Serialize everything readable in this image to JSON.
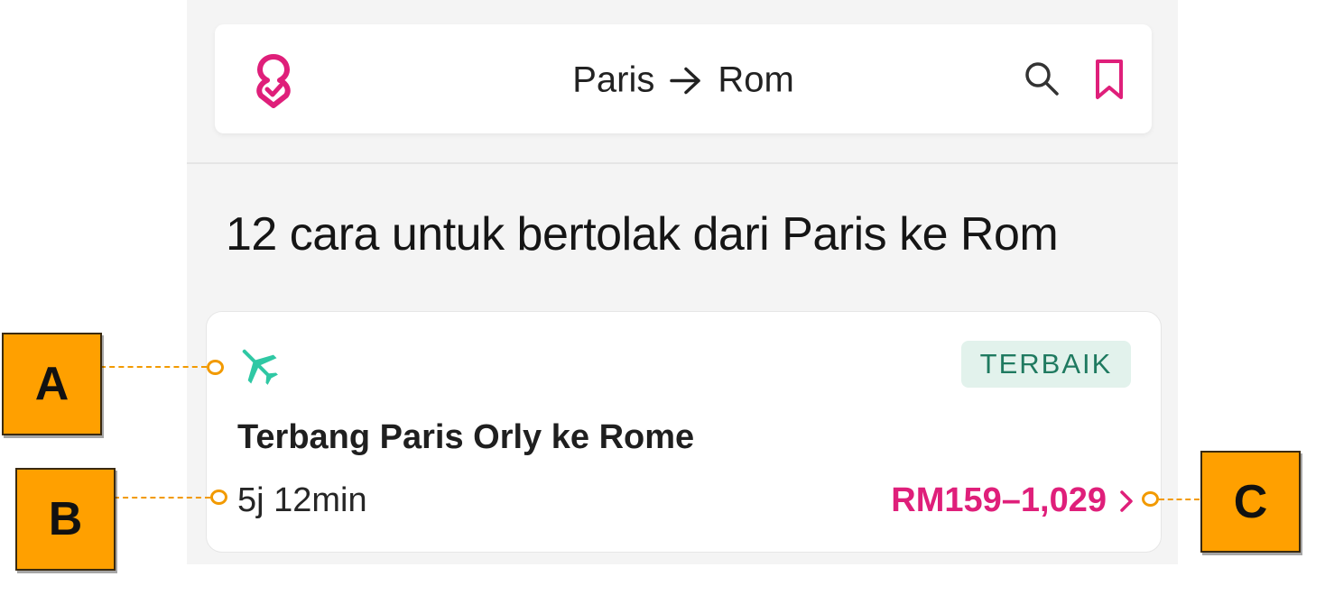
{
  "header": {
    "origin": "Paris",
    "destination": "Rom",
    "icons": {
      "logo": "rome2rio-logo-icon",
      "arrow": "arrow-right-icon",
      "search": "search-icon",
      "bookmark": "bookmark-icon"
    }
  },
  "page": {
    "title": "12 cara untuk bertolak dari Paris ke Rom"
  },
  "option": {
    "icon": "plane-icon",
    "badge": "TERBAIK",
    "title": "Terbang Paris Orly ke Rome",
    "duration": "5j 12min",
    "price": "RM159–1,029"
  },
  "callouts": {
    "a": "A",
    "b": "B",
    "c": "C"
  },
  "colors": {
    "brand": "#df1f7a",
    "plane": "#2fc8a4",
    "badge_bg": "#e2f2ec",
    "badge_text": "#1f7a60",
    "callout": "#ffa000"
  }
}
